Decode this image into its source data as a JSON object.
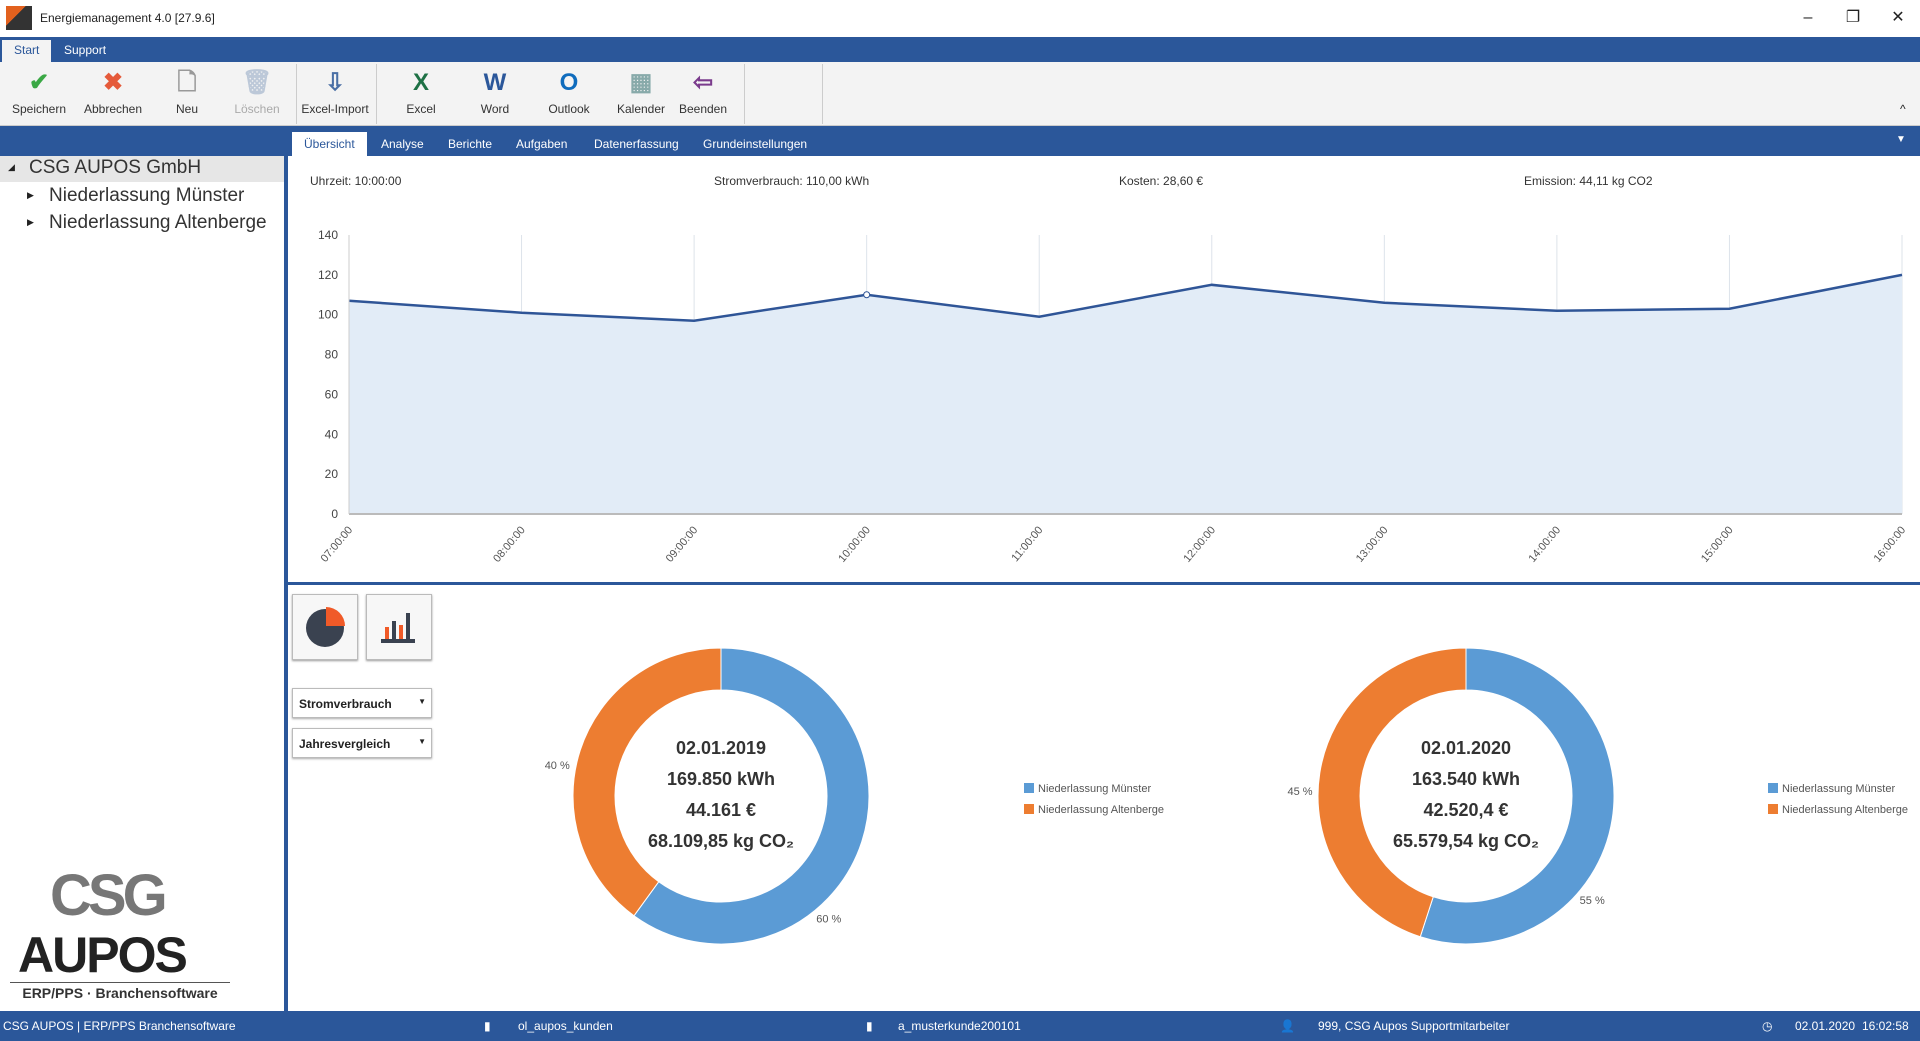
{
  "window": {
    "title": "Energiemanagement 4.0 [27.9.6]",
    "minimize": "–",
    "restore": "❐",
    "close": "✕"
  },
  "menu": {
    "tabs": [
      "Start",
      "Support"
    ]
  },
  "ribbon": {
    "buttons": [
      {
        "label": "Speichern",
        "icon": "check-icon",
        "glyph": "✔",
        "color": "#3aa845"
      },
      {
        "label": "Abbrechen",
        "icon": "cancel-x-icon",
        "glyph": "✖",
        "color": "#e55a3a"
      },
      {
        "label": "Neu",
        "icon": "new-document-icon",
        "glyph": "🗋",
        "color": "#999"
      },
      {
        "label": "Löschen",
        "icon": "trash-icon",
        "glyph": "🗑",
        "color": "#bcc8d8"
      },
      {
        "label": "Excel-Import",
        "icon": "import-icon",
        "glyph": "⇩",
        "color": "#4a6fa5"
      },
      {
        "label": "Excel",
        "icon": "excel-icon",
        "glyph": "X",
        "color": "#1e7145"
      },
      {
        "label": "Word",
        "icon": "word-icon",
        "glyph": "W",
        "color": "#2b579a"
      },
      {
        "label": "Outlook",
        "icon": "outlook-icon",
        "glyph": "O",
        "color": "#0f6cbd"
      },
      {
        "label": "Kalender",
        "icon": "calendar-icon",
        "glyph": "▦",
        "color": "#8aa"
      },
      {
        "label": "Beenden",
        "icon": "exit-icon",
        "glyph": "⇦",
        "color": "#7a3b8c"
      }
    ],
    "collapse": "^"
  },
  "nav": {
    "tabs": [
      "Übersicht",
      "Analyse",
      "Berichte",
      "Aufgaben",
      "Datenerfassung",
      "Grundeinstellungen"
    ],
    "menu": "▼"
  },
  "tree": {
    "root": "CSG AUPOS GmbH",
    "children": [
      "Niederlassung Münster",
      "Niederlassung Altenberge"
    ]
  },
  "info": {
    "time": "Uhrzeit:  10:00:00",
    "consumption": "Stromverbrauch:  110,00 kWh",
    "cost": "Kosten:  28,60 €",
    "emission": "Emission:  44,11 kg CO2"
  },
  "chart_data": [
    {
      "type": "area",
      "x": [
        "07:00:00",
        "08:00:00",
        "09:00:00",
        "10:00:00",
        "11:00:00",
        "12:00:00",
        "13:00:00",
        "14:00:00",
        "15:00:00",
        "16:00:00"
      ],
      "values": [
        107,
        101,
        97,
        110,
        99,
        115,
        106,
        102,
        103,
        120
      ],
      "ylim": [
        0,
        140
      ],
      "yticks": [
        0,
        20,
        40,
        60,
        80,
        100,
        120,
        140
      ],
      "grid": "vertical",
      "line_color": "#2f5597",
      "fill_color": "#e2ecf7",
      "highlighted": "10:00:00"
    },
    {
      "type": "pie",
      "donut": true,
      "categories": [
        "Niederlassung Münster",
        "Niederlassung Altenberge"
      ],
      "values": [
        60,
        40
      ],
      "labels": [
        "60 %",
        "40 %"
      ],
      "center": [
        "02.01.2019",
        "169.850 kWh",
        "44.161 €",
        "68.109,85 kg CO₂"
      ],
      "colors": [
        "#5b9bd5",
        "#ed7d31"
      ],
      "legend": "right"
    },
    {
      "type": "pie",
      "donut": true,
      "categories": [
        "Niederlassung Münster",
        "Niederlassung Altenberge"
      ],
      "values": [
        55,
        45
      ],
      "labels": [
        "55 %",
        "45 %"
      ],
      "center": [
        "02.01.2020",
        "163.540 kWh",
        "42.520,4 €",
        "65.579,54 kg CO₂"
      ],
      "colors": [
        "#5b9bd5",
        "#ed7d31"
      ],
      "legend": "right"
    }
  ],
  "controls": {
    "measure": "Stromverbrauch",
    "mode": "Jahresvergleich"
  },
  "logo": {
    "top": "CSG",
    "main": "AUPOS",
    "sub": "ERP/PPS · Branchensoftware"
  },
  "status": {
    "app": "CSG AUPOS | ERP/PPS Branchensoftware",
    "db": "ol_aupos_kunden",
    "client": "a_musterkunde200101",
    "user": "999, CSG Aupos Supportmitarbeiter",
    "date": "02.01.2020",
    "time": "16:02:58"
  }
}
